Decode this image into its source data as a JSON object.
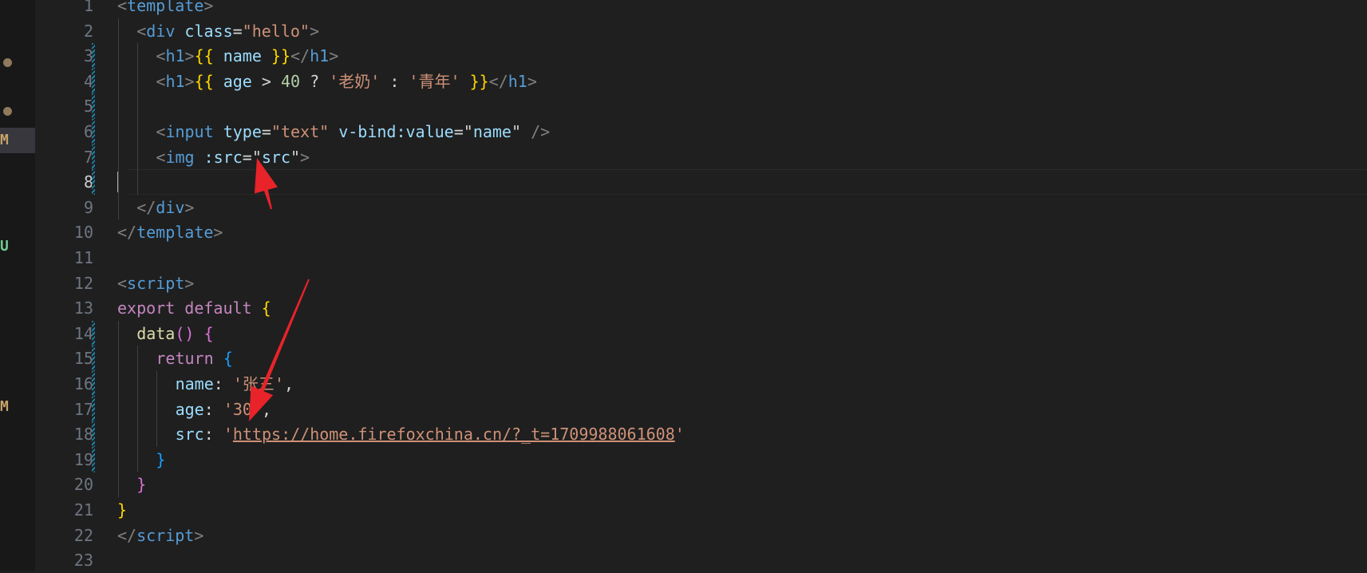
{
  "sidebar": {
    "badges": [
      {
        "label": "M",
        "color": "#c8a26b"
      },
      {
        "label": "U",
        "color": "#73c991"
      },
      {
        "label": "M",
        "color": "#c8a26b"
      }
    ]
  },
  "editor": {
    "active_line": 8,
    "lines": [
      {
        "n": "1",
        "tokens": [
          {
            "t": "<",
            "c": "t-br"
          },
          {
            "t": "template",
            "c": "t-tag"
          },
          {
            "t": ">",
            "c": "t-br"
          }
        ]
      },
      {
        "n": "2",
        "tokens": [
          {
            "t": "<",
            "c": "t-br"
          },
          {
            "t": "div",
            "c": "t-tag"
          },
          {
            "t": " ",
            "c": "t-op"
          },
          {
            "t": "class",
            "c": "t-attr"
          },
          {
            "t": "=",
            "c": "t-op"
          },
          {
            "t": "\"hello\"",
            "c": "t-str"
          },
          {
            "t": ">",
            "c": "t-br"
          }
        ]
      },
      {
        "n": "3",
        "tokens": [
          {
            "t": "<",
            "c": "t-br"
          },
          {
            "t": "h1",
            "c": "t-tag"
          },
          {
            "t": ">",
            "c": "t-br"
          },
          {
            "t": "{{",
            "c": "t-mus"
          },
          {
            "t": " name ",
            "c": "t-attr"
          },
          {
            "t": "}}",
            "c": "t-mus"
          },
          {
            "t": "</",
            "c": "t-br"
          },
          {
            "t": "h1",
            "c": "t-tag"
          },
          {
            "t": ">",
            "c": "t-br"
          }
        ]
      },
      {
        "n": "4",
        "tokens": [
          {
            "t": "<",
            "c": "t-br"
          },
          {
            "t": "h1",
            "c": "t-tag"
          },
          {
            "t": ">",
            "c": "t-br"
          },
          {
            "t": "{{",
            "c": "t-mus"
          },
          {
            "t": " age ",
            "c": "t-attr"
          },
          {
            "t": "> ",
            "c": "t-op"
          },
          {
            "t": "40",
            "c": "t-num"
          },
          {
            "t": " ? ",
            "c": "t-op"
          },
          {
            "t": "'老奶'",
            "c": "t-str"
          },
          {
            "t": " : ",
            "c": "t-op"
          },
          {
            "t": "'青年'",
            "c": "t-str"
          },
          {
            "t": " ",
            "c": "t-op"
          },
          {
            "t": "}}",
            "c": "t-mus"
          },
          {
            "t": "</",
            "c": "t-br"
          },
          {
            "t": "h1",
            "c": "t-tag"
          },
          {
            "t": ">",
            "c": "t-br"
          }
        ]
      },
      {
        "n": "5",
        "tokens": []
      },
      {
        "n": "6",
        "tokens": [
          {
            "t": "<",
            "c": "t-br"
          },
          {
            "t": "input",
            "c": "t-tag"
          },
          {
            "t": " ",
            "c": "t-op"
          },
          {
            "t": "type",
            "c": "t-attr"
          },
          {
            "t": "=",
            "c": "t-op"
          },
          {
            "t": "\"text\"",
            "c": "t-str"
          },
          {
            "t": " ",
            "c": "t-op"
          },
          {
            "t": "v-bind:value",
            "c": "t-attr"
          },
          {
            "t": "=",
            "c": "t-op"
          },
          {
            "t": "\"",
            "c": "t-op"
          },
          {
            "t": "name",
            "c": "t-attr"
          },
          {
            "t": "\"",
            "c": "t-op"
          },
          {
            "t": " ",
            "c": "t-op"
          },
          {
            "t": "/>",
            "c": "t-br"
          }
        ]
      },
      {
        "n": "7",
        "tokens": [
          {
            "t": "<",
            "c": "t-br"
          },
          {
            "t": "img",
            "c": "t-tag"
          },
          {
            "t": " ",
            "c": "t-op"
          },
          {
            "t": ":src",
            "c": "t-attr"
          },
          {
            "t": "=",
            "c": "t-op"
          },
          {
            "t": "\"",
            "c": "t-op"
          },
          {
            "t": "src",
            "c": "t-attr"
          },
          {
            "t": "\"",
            "c": "t-op"
          },
          {
            "t": ">",
            "c": "t-br"
          }
        ]
      },
      {
        "n": "8",
        "tokens": []
      },
      {
        "n": "9",
        "tokens": [
          {
            "t": "</",
            "c": "t-br"
          },
          {
            "t": "div",
            "c": "t-tag"
          },
          {
            "t": ">",
            "c": "t-br"
          }
        ]
      },
      {
        "n": "10",
        "tokens": [
          {
            "t": "</",
            "c": "t-br"
          },
          {
            "t": "template",
            "c": "t-tag"
          },
          {
            "t": ">",
            "c": "t-br"
          }
        ]
      },
      {
        "n": "11",
        "tokens": []
      },
      {
        "n": "12",
        "tokens": [
          {
            "t": "<",
            "c": "t-br"
          },
          {
            "t": "script",
            "c": "t-tag"
          },
          {
            "t": ">",
            "c": "t-br"
          }
        ]
      },
      {
        "n": "13",
        "tokens": [
          {
            "t": "export",
            "c": "t-kw"
          },
          {
            "t": " ",
            "c": "t-op"
          },
          {
            "t": "default",
            "c": "t-kw"
          },
          {
            "t": " ",
            "c": "t-op"
          },
          {
            "t": "{",
            "c": "t-p1"
          }
        ]
      },
      {
        "n": "14",
        "tokens": [
          {
            "t": "data",
            "c": "t-fn"
          },
          {
            "t": "()",
            "c": "t-p2"
          },
          {
            "t": " ",
            "c": "t-op"
          },
          {
            "t": "{",
            "c": "t-p2"
          }
        ]
      },
      {
        "n": "15",
        "tokens": [
          {
            "t": "return",
            "c": "t-kw"
          },
          {
            "t": " ",
            "c": "t-op"
          },
          {
            "t": "{",
            "c": "t-p3"
          }
        ]
      },
      {
        "n": "16",
        "tokens": [
          {
            "t": "name",
            "c": "t-attr"
          },
          {
            "t": ": ",
            "c": "t-op"
          },
          {
            "t": "'张三'",
            "c": "t-str"
          },
          {
            "t": ",",
            "c": "t-op"
          }
        ]
      },
      {
        "n": "17",
        "tokens": [
          {
            "t": "age",
            "c": "t-attr"
          },
          {
            "t": ": ",
            "c": "t-op"
          },
          {
            "t": "'30'",
            "c": "t-str"
          },
          {
            "t": ",",
            "c": "t-op"
          }
        ]
      },
      {
        "n": "18",
        "tokens": [
          {
            "t": "src",
            "c": "t-attr"
          },
          {
            "t": ": ",
            "c": "t-op"
          },
          {
            "t": "'",
            "c": "t-str"
          },
          {
            "t": "https://home.firefoxchina.cn/?_t=1709988061608",
            "c": "t-link"
          },
          {
            "t": "'",
            "c": "t-str"
          }
        ]
      },
      {
        "n": "19",
        "tokens": [
          {
            "t": "}",
            "c": "t-p3"
          }
        ]
      },
      {
        "n": "20",
        "tokens": [
          {
            "t": "}",
            "c": "t-p2"
          }
        ]
      },
      {
        "n": "21",
        "tokens": [
          {
            "t": "}",
            "c": "t-p1"
          }
        ]
      },
      {
        "n": "22",
        "tokens": [
          {
            "t": "</",
            "c": "t-br"
          },
          {
            "t": "script",
            "c": "t-tag"
          },
          {
            "t": ">",
            "c": "t-br"
          }
        ]
      },
      {
        "n": "23",
        "tokens": []
      }
    ]
  },
  "annotations": {
    "arrow_color": "#e8232a"
  }
}
